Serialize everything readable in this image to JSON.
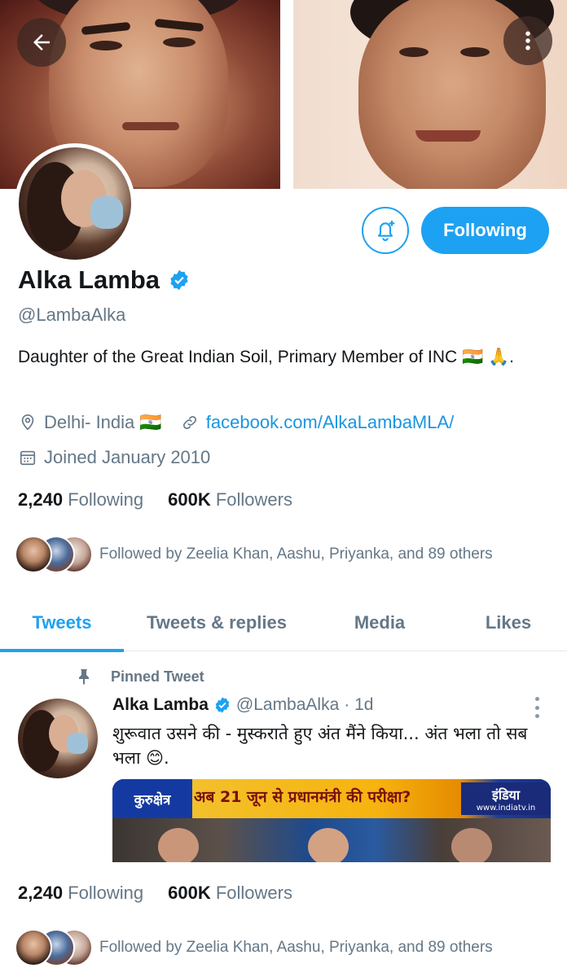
{
  "profile": {
    "name": "Alka Lamba",
    "handle": "@LambaAlka",
    "bio": "Daughter of the Great Indian Soil, Primary Member of INC 🇮🇳 🙏.",
    "location": "Delhi- India 🇮🇳",
    "website": "facebook.com/AlkaLambaMLA/",
    "joined": "Joined January 2010",
    "verified": true
  },
  "actions": {
    "following_label": "Following"
  },
  "stats": {
    "following_count": "2,240",
    "following_label": "Following",
    "followers_count": "600K",
    "followers_label": "Followers"
  },
  "followed_by": "Followed by Zeelia Khan, Aashu, Priyanka, and 89 others",
  "tabs": [
    {
      "label": "Tweets",
      "active": true
    },
    {
      "label": "Tweets & replies",
      "active": false
    },
    {
      "label": "Media",
      "active": false
    },
    {
      "label": "Likes",
      "active": false
    }
  ],
  "pinned_tweet": {
    "pinned_label": "Pinned Tweet",
    "author_name": "Alka Lamba",
    "author_handle": "@LambaAlka",
    "time": "· 1d",
    "text": "शुरूवात उसने की - मुस्कराते हुए अंत मैंने किया... अंत भला तो सब भला 😊.",
    "media": {
      "badge": "कुरुक्षेत्र",
      "headline": "अब 21 जून से प्रधानमंत्री की परीक्षा?",
      "logo": "इंडिया",
      "logo_url": "www.indiatv.in"
    }
  },
  "colors": {
    "accent": "#1da1f2",
    "secondary_text": "#657786",
    "primary_text": "#14171a"
  }
}
